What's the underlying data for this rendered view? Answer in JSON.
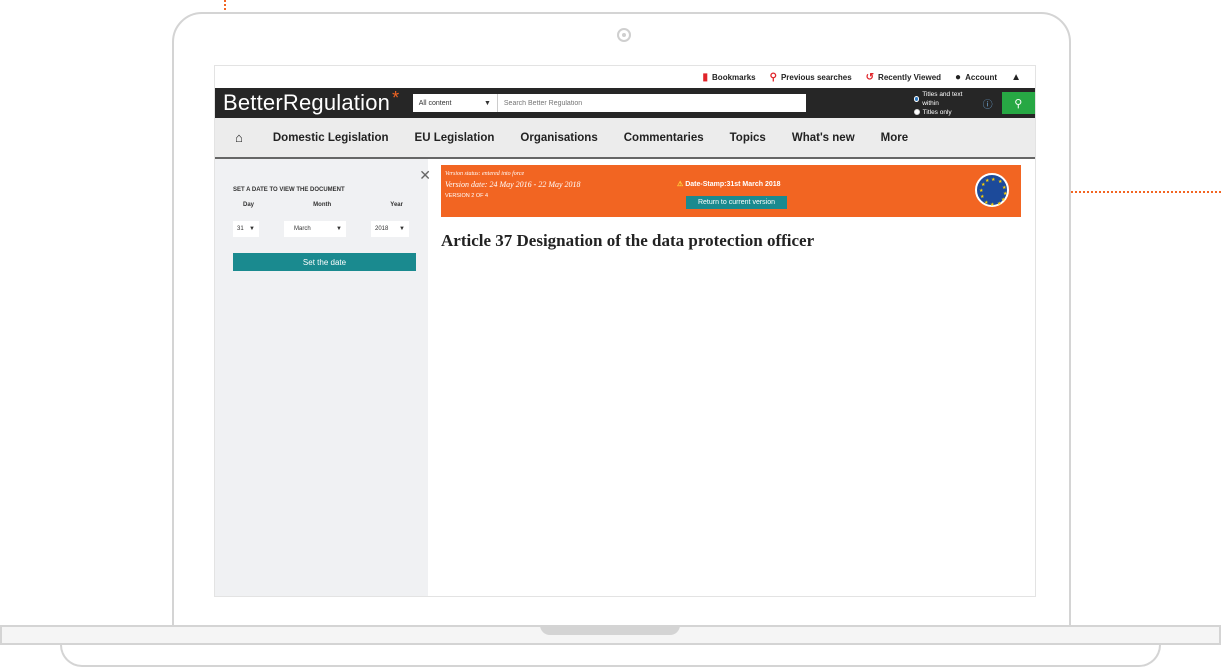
{
  "topbar": {
    "bookmarks": "Bookmarks",
    "previous_searches": "Previous searches",
    "recently_viewed": "Recently Viewed",
    "account": "Account"
  },
  "brand": {
    "name": "BetterRegulation",
    "mark": "*"
  },
  "search": {
    "content_filter": "All content",
    "placeholder": "Search Better Regulation",
    "option_titles_text": "Titles and text within",
    "option_titles_only": "Titles only"
  },
  "nav": {
    "items": [
      "Domestic Legislation",
      "EU Legislation",
      "Organisations",
      "Commentaries",
      "Topics",
      "What's new",
      "More"
    ]
  },
  "date_panel": {
    "title": "SET A DATE TO VIEW THE DOCUMENT",
    "day_label": "Day",
    "month_label": "Month",
    "year_label": "Year",
    "day": "31",
    "month": "March",
    "year": "2018",
    "button": "Set the date"
  },
  "banner": {
    "status": "Version status: entered into force",
    "version_date": "Version date: 24 May 2016 - 22 May 2018",
    "version_num": "VERSION 2 OF 4",
    "stamp": "Date-Stamp:31st March 2018",
    "return": "Return to current version"
  },
  "article": {
    "title": "Article 37 Designation of the data protection officer"
  },
  "colors": {
    "accent": "#f26522",
    "teal": "#1a8a8f",
    "link": "#2f86c9",
    "dark": "#262626",
    "search_green": "#27a844"
  },
  "icons": [
    "bookmark-icon",
    "search-icon",
    "history-icon",
    "user-icon",
    "bell-icon",
    "home-icon",
    "close-icon",
    "info-icon",
    "warning-icon",
    "eu-flag-icon"
  ]
}
